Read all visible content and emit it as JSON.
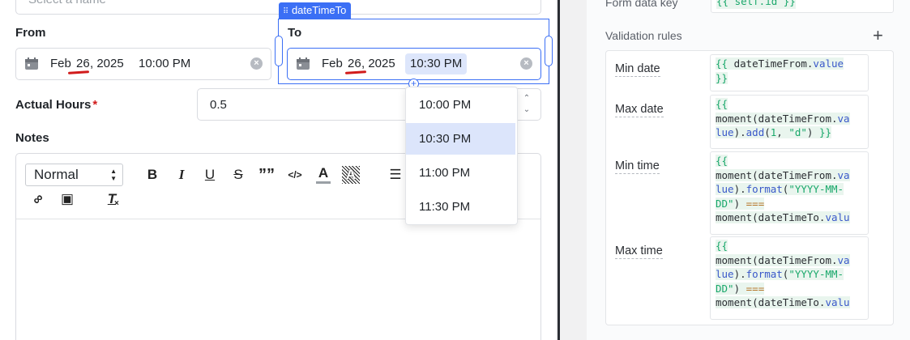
{
  "top_partial": {
    "name_select_placeholder": "Select a name"
  },
  "from_field": {
    "label": "From",
    "month": "Feb",
    "day": "26",
    "year": ", 2025",
    "time": "10:00 PM"
  },
  "to_field": {
    "label": "To",
    "component_tag": "dateTimeTo",
    "month": "Feb",
    "day": "26",
    "year": ", 2025",
    "time": "10:30 PM"
  },
  "time_dropdown": {
    "options": [
      "10:00 PM",
      "10:30 PM",
      "11:00 PM",
      "11:30 PM"
    ],
    "selected_index": 1
  },
  "actual_hours": {
    "label": "Actual Hours",
    "required_mark": "*",
    "value": "0.5"
  },
  "notes": {
    "label": "Notes",
    "format_select": "Normal",
    "toolbar_icons": [
      "bold-icon",
      "italic-icon",
      "underline-icon",
      "strikethrough-icon",
      "quote-icon",
      "code-icon",
      "font-color-icon",
      "background-color-icon",
      "ordered-list-icon",
      "link-icon",
      "image-icon",
      "clear-format-icon"
    ],
    "toolbar_glyphs": {
      "bold": "B",
      "italic": "I",
      "underline": "U",
      "strike": "S",
      "quote": "””",
      "code": "</>",
      "color": "A",
      "bg": "A",
      "list": "☰",
      "link": "∞",
      "image": "▣",
      "clear": "T"
    }
  },
  "right_panel": {
    "form_data_key_label": "Form data key",
    "form_data_key_value": "{{ self.id }}",
    "validation_rules_label": "Validation rules",
    "add_icon": "+",
    "rules": [
      {
        "label": "Min date",
        "lines": [
          [
            {
              "t": "{{ ",
              "c": "brace"
            },
            {
              "t": "dateTimeFrom.",
              "c": ""
            },
            {
              "t": "value",
              "c": "prop"
            }
          ],
          [
            {
              "t": "}}",
              "c": "brace"
            }
          ]
        ]
      },
      {
        "label": "Max date",
        "lines": [
          [
            {
              "t": "{{",
              "c": "brace"
            }
          ],
          [
            {
              "t": "moment(dateTimeFrom.",
              "c": ""
            },
            {
              "t": "va",
              "c": "prop"
            }
          ],
          [
            {
              "t": "lue",
              "c": "prop"
            },
            {
              "t": ").",
              "c": ""
            },
            {
              "t": "add",
              "c": "prop"
            },
            {
              "t": "(",
              "c": ""
            },
            {
              "t": "1",
              "c": "str"
            },
            {
              "t": ", ",
              "c": ""
            },
            {
              "t": "\"d\"",
              "c": "str"
            },
            {
              "t": ") ",
              "c": ""
            },
            {
              "t": "}}",
              "c": "brace"
            }
          ]
        ]
      },
      {
        "label": "Min time",
        "lines": [
          [
            {
              "t": "{{",
              "c": "brace"
            }
          ],
          [
            {
              "t": "moment(dateTimeFrom.",
              "c": ""
            },
            {
              "t": "va",
              "c": "prop"
            }
          ],
          [
            {
              "t": "lue",
              "c": "prop"
            },
            {
              "t": ").",
              "c": ""
            },
            {
              "t": "format",
              "c": "prop"
            },
            {
              "t": "(",
              "c": ""
            },
            {
              "t": "\"YYYY-MM-",
              "c": "str"
            }
          ],
          [
            {
              "t": "DD\"",
              "c": "str"
            },
            {
              "t": ") ",
              "c": ""
            },
            {
              "t": "===",
              "c": "op"
            }
          ],
          [
            {
              "t": "moment(dateTimeTo.",
              "c": ""
            },
            {
              "t": "valu",
              "c": "prop"
            }
          ]
        ]
      },
      {
        "label": "Max time",
        "lines": [
          [
            {
              "t": "{{",
              "c": "brace"
            }
          ],
          [
            {
              "t": "moment(dateTimeFrom.",
              "c": ""
            },
            {
              "t": "va",
              "c": "prop"
            }
          ],
          [
            {
              "t": "lue",
              "c": "prop"
            },
            {
              "t": ").",
              "c": ""
            },
            {
              "t": "format",
              "c": "prop"
            },
            {
              "t": "(",
              "c": ""
            },
            {
              "t": "\"YYYY-MM-",
              "c": "str"
            }
          ],
          [
            {
              "t": "DD\"",
              "c": "str"
            },
            {
              "t": ") ",
              "c": ""
            },
            {
              "t": "===",
              "c": "op"
            }
          ],
          [
            {
              "t": "moment(dateTimeTo.",
              "c": ""
            },
            {
              "t": "valu",
              "c": "prop"
            }
          ]
        ]
      }
    ]
  },
  "colors": {
    "accent": "#3b6ff5",
    "selected_option_bg": "#dce5fb",
    "required": "#d11b1b",
    "code_green": "#1aa86b",
    "code_blue": "#3958c9"
  }
}
